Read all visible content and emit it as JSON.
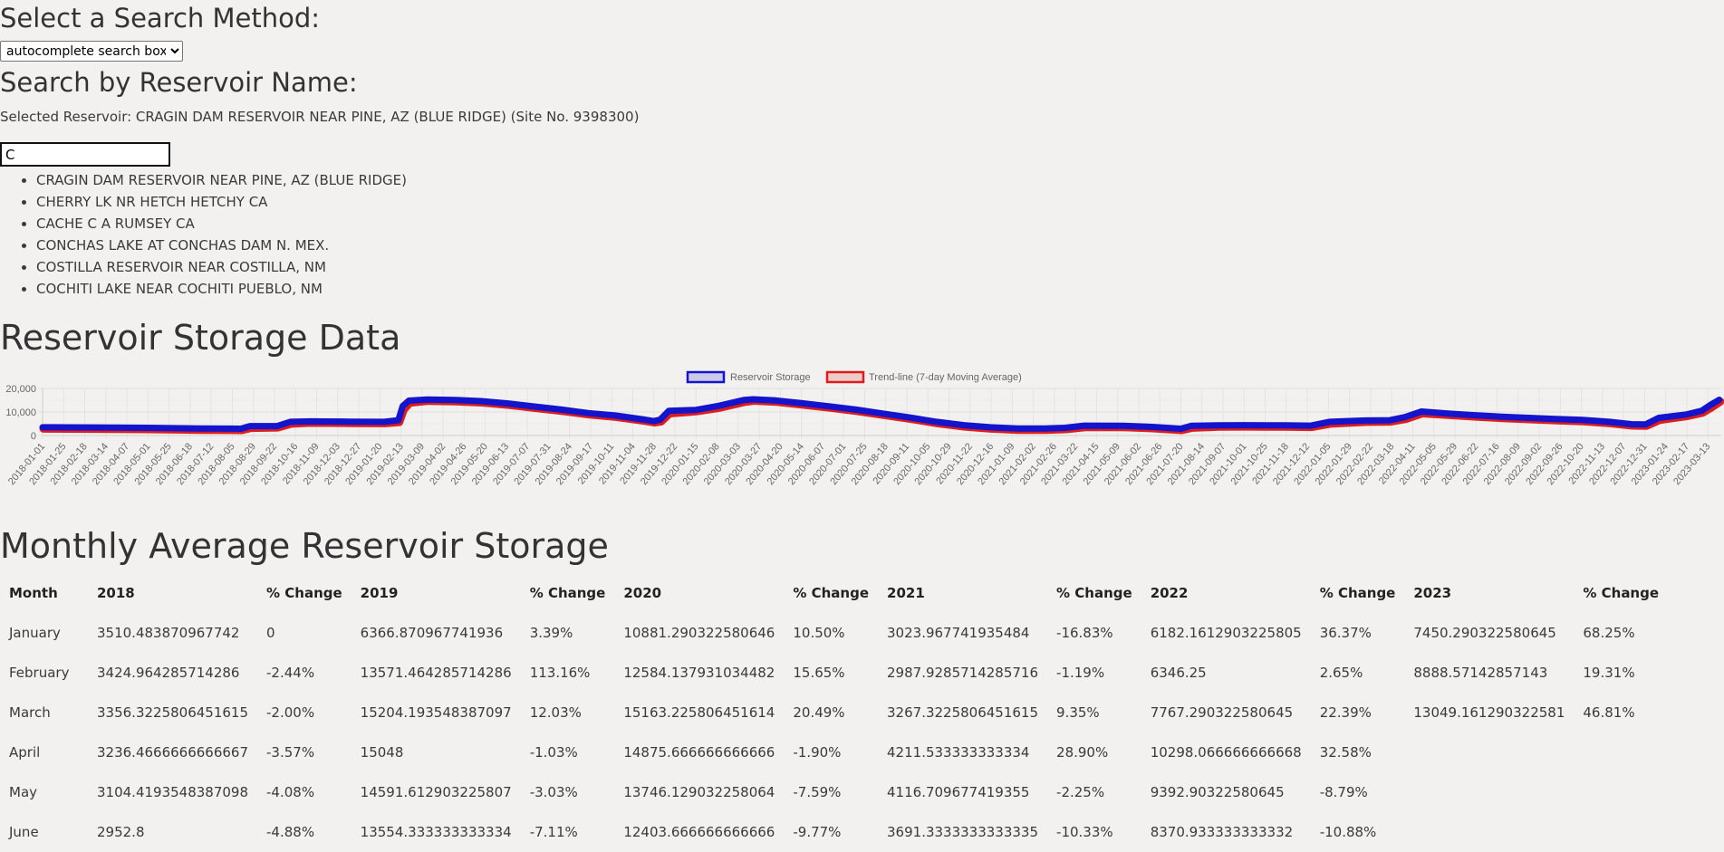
{
  "search": {
    "method_heading": "Select a Search Method:",
    "method_selected": "autocomplete search box",
    "name_heading": "Search by Reservoir Name:",
    "selected_text": "Selected Reservoir: CRAGIN DAM RESERVOIR NEAR PINE, AZ (BLUE RIDGE) (Site No. 9398300)",
    "input_value": "C",
    "suggestions": [
      "CRAGIN DAM RESERVOIR NEAR PINE, AZ (BLUE RIDGE)",
      "CHERRY LK NR HETCH HETCHY CA",
      "CACHE C A RUMSEY CA",
      "CONCHAS LAKE AT CONCHAS DAM N. MEX.",
      "COSTILLA RESERVOIR NEAR COSTILLA, NM",
      "COCHITI LAKE NEAR COCHITI PUEBLO, NM"
    ]
  },
  "storage_heading": "Reservoir Storage Data",
  "monthly_heading": "Monthly Average Reservoir Storage",
  "chart_data": {
    "type": "line",
    "colors": {
      "storage": "#1414cc",
      "trend": "#dd1c1c"
    },
    "legend_position": "top-center",
    "grid": true,
    "ylim": [
      0,
      20000
    ],
    "y_ticks": [
      "0",
      "10,000",
      "20,000"
    ],
    "x_ticks": [
      "2018-01-01",
      "2018-01-25",
      "2018-02-18",
      "2018-03-14",
      "2018-04-07",
      "2018-05-01",
      "2018-05-25",
      "2018-06-18",
      "2018-07-12",
      "2018-08-05",
      "2018-08-29",
      "2018-09-22",
      "2018-10-16",
      "2018-11-09",
      "2018-12-03",
      "2018-12-27",
      "2019-01-20",
      "2019-02-13",
      "2019-03-09",
      "2019-04-02",
      "2019-04-26",
      "2019-05-20",
      "2019-06-13",
      "2019-07-07",
      "2019-07-31",
      "2019-08-24",
      "2019-09-17",
      "2019-10-11",
      "2019-11-04",
      "2019-11-28",
      "2019-12-22",
      "2020-01-15",
      "2020-02-08",
      "2020-03-03",
      "2020-03-27",
      "2020-04-20",
      "2020-05-14",
      "2020-06-07",
      "2020-07-01",
      "2020-07-25",
      "2020-08-18",
      "2020-09-11",
      "2020-10-05",
      "2020-10-29",
      "2020-11-22",
      "2020-12-16",
      "2021-01-09",
      "2021-02-02",
      "2021-02-26",
      "2021-03-22",
      "2021-04-15",
      "2021-05-09",
      "2021-06-02",
      "2021-06-26",
      "2021-07-20",
      "2021-08-14",
      "2021-09-07",
      "2021-10-01",
      "2021-10-25",
      "2021-11-18",
      "2021-12-12",
      "2022-01-05",
      "2022-01-29",
      "2022-02-22",
      "2022-03-18",
      "2022-04-11",
      "2022-05-05",
      "2022-05-29",
      "2022-06-22",
      "2022-07-16",
      "2022-08-09",
      "2022-09-02",
      "2022-09-26",
      "2022-10-20",
      "2022-11-13",
      "2022-12-07",
      "2022-12-31",
      "2023-01-24",
      "2023-02-17",
      "2023-03-13"
    ],
    "series": [
      {
        "name": "Reservoir Storage",
        "x": [
          "2018-01-01",
          "2018-03-01",
          "2018-05-01",
          "2018-07-01",
          "2018-08-15",
          "2018-08-25",
          "2018-09-25",
          "2018-10-10",
          "2018-11-01",
          "2018-12-15",
          "2019-01-25",
          "2019-02-10",
          "2019-02-15",
          "2019-02-22",
          "2019-03-15",
          "2019-04-15",
          "2019-05-15",
          "2019-06-15",
          "2019-07-15",
          "2019-08-15",
          "2019-09-15",
          "2019-10-15",
          "2019-11-15",
          "2019-11-28",
          "2019-12-05",
          "2019-12-15",
          "2020-01-15",
          "2020-02-10",
          "2020-03-10",
          "2020-03-20",
          "2020-04-15",
          "2020-05-15",
          "2020-06-15",
          "2020-07-15",
          "2020-08-15",
          "2020-09-15",
          "2020-10-15",
          "2020-11-15",
          "2020-12-15",
          "2021-01-15",
          "2021-02-15",
          "2021-03-10",
          "2021-04-01",
          "2021-05-15",
          "2021-06-15",
          "2021-07-20",
          "2021-08-01",
          "2021-09-01",
          "2021-10-01",
          "2021-11-15",
          "2021-12-15",
          "2022-01-05",
          "2022-02-15",
          "2022-03-15",
          "2022-04-01",
          "2022-04-20",
          "2022-05-20",
          "2022-06-20",
          "2022-07-20",
          "2022-08-20",
          "2022-09-20",
          "2022-10-20",
          "2022-11-20",
          "2022-12-15",
          "2022-12-31",
          "2023-01-15",
          "2023-02-15",
          "2023-03-05",
          "2023-03-15",
          "2023-03-25"
        ],
        "values": [
          3500,
          3420,
          3250,
          3000,
          2900,
          4000,
          4000,
          5800,
          6000,
          5900,
          5800,
          6500,
          12500,
          14800,
          15300,
          15100,
          14600,
          13600,
          12300,
          11000,
          9500,
          8500,
          6900,
          6100,
          6700,
          10500,
          10900,
          12600,
          15100,
          15400,
          14900,
          13700,
          12400,
          11000,
          9300,
          7600,
          5800,
          4400,
          3500,
          3000,
          2990,
          3270,
          4200,
          4100,
          3700,
          2900,
          4100,
          4300,
          4400,
          4300,
          4200,
          5800,
          6400,
          6500,
          7800,
          10200,
          9300,
          8600,
          8000,
          7500,
          7000,
          6600,
          5800,
          4800,
          4700,
          7500,
          8900,
          10500,
          13000,
          15200
        ]
      },
      {
        "name": "Trend-line (7-day Moving Average)",
        "x": [
          "2018-01-01",
          "2018-03-01",
          "2018-05-01",
          "2018-07-01",
          "2018-08-15",
          "2018-08-25",
          "2018-09-25",
          "2018-10-10",
          "2018-11-01",
          "2018-12-15",
          "2019-01-25",
          "2019-02-10",
          "2019-02-15",
          "2019-02-22",
          "2019-03-15",
          "2019-04-15",
          "2019-05-15",
          "2019-06-15",
          "2019-07-15",
          "2019-08-15",
          "2019-09-15",
          "2019-10-15",
          "2019-11-15",
          "2019-11-28",
          "2019-12-05",
          "2019-12-15",
          "2020-01-15",
          "2020-02-10",
          "2020-03-10",
          "2020-03-20",
          "2020-04-15",
          "2020-05-15",
          "2020-06-15",
          "2020-07-15",
          "2020-08-15",
          "2020-09-15",
          "2020-10-15",
          "2020-11-15",
          "2020-12-15",
          "2021-01-15",
          "2021-02-15",
          "2021-03-10",
          "2021-04-01",
          "2021-05-15",
          "2021-06-15",
          "2021-07-20",
          "2021-08-01",
          "2021-09-01",
          "2021-10-01",
          "2021-11-15",
          "2021-12-15",
          "2022-01-05",
          "2022-02-15",
          "2022-03-15",
          "2022-04-01",
          "2022-04-20",
          "2022-05-20",
          "2022-06-20",
          "2022-07-20",
          "2022-08-20",
          "2022-09-20",
          "2022-10-20",
          "2022-11-20",
          "2022-12-15",
          "2022-12-31",
          "2023-01-15",
          "2023-02-15",
          "2023-03-05",
          "2023-03-15",
          "2023-03-25"
        ],
        "values": [
          3500,
          3420,
          3250,
          3000,
          2900,
          3800,
          4000,
          5600,
          6000,
          5900,
          5800,
          6300,
          11500,
          14500,
          15300,
          15100,
          14600,
          13600,
          12300,
          11000,
          9500,
          8500,
          6900,
          6100,
          6500,
          10000,
          10900,
          12400,
          14900,
          15400,
          14900,
          13700,
          12400,
          11000,
          9300,
          7600,
          5800,
          4400,
          3500,
          3000,
          2990,
          3270,
          4100,
          4100,
          3700,
          2900,
          3900,
          4300,
          4400,
          4300,
          4200,
          5600,
          6400,
          6500,
          7600,
          10000,
          9300,
          8600,
          8000,
          7500,
          7000,
          6600,
          5800,
          4800,
          4700,
          7200,
          8800,
          10300,
          12500,
          15000
        ]
      }
    ]
  },
  "table": {
    "headers": [
      "Month",
      "2018",
      "% Change",
      "2019",
      "% Change",
      "2020",
      "% Change",
      "2021",
      "% Change",
      "2022",
      "% Change",
      "2023",
      "% Change"
    ],
    "rows": [
      [
        "January",
        "3510.483870967742",
        "0",
        "6366.870967741936",
        "3.39%",
        "10881.290322580646",
        "10.50%",
        "3023.967741935484",
        "-16.83%",
        "6182.1612903225805",
        "36.37%",
        "7450.290322580645",
        "68.25%"
      ],
      [
        "February",
        "3424.964285714286",
        "-2.44%",
        "13571.464285714286",
        "113.16%",
        "12584.137931034482",
        "15.65%",
        "2987.9285714285716",
        "-1.19%",
        "6346.25",
        "2.65%",
        "8888.57142857143",
        "19.31%"
      ],
      [
        "March",
        "3356.3225806451615",
        "-2.00%",
        "15204.193548387097",
        "12.03%",
        "15163.225806451614",
        "20.49%",
        "3267.3225806451615",
        "9.35%",
        "7767.290322580645",
        "22.39%",
        "13049.161290322581",
        "46.81%"
      ],
      [
        "April",
        "3236.4666666666667",
        "-3.57%",
        "15048",
        "-1.03%",
        "14875.666666666666",
        "-1.90%",
        "4211.533333333334",
        "28.90%",
        "10298.066666666668",
        "32.58%",
        "",
        ""
      ],
      [
        "May",
        "3104.4193548387098",
        "-4.08%",
        "14591.612903225807",
        "-3.03%",
        "13746.129032258064",
        "-7.59%",
        "4116.709677419355",
        "-2.25%",
        "9392.90322580645",
        "-8.79%",
        "",
        ""
      ],
      [
        "June",
        "2952.8",
        "-4.88%",
        "13554.333333333334",
        "-7.11%",
        "12403.666666666666",
        "-9.77%",
        "3691.3333333333335",
        "-10.33%",
        "8370.933333333332",
        "-10.88%",
        "",
        ""
      ]
    ]
  }
}
